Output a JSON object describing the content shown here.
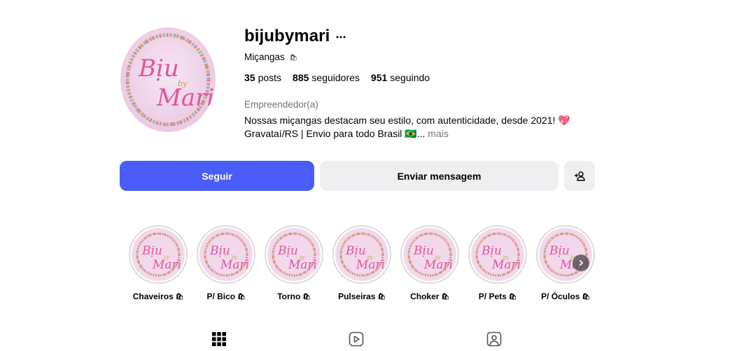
{
  "profile": {
    "username": "bijubymari",
    "category": "Miçangas",
    "category_emoji": "🛍",
    "posts_count": "35",
    "posts_label": "posts",
    "followers_count": "885",
    "followers_label": "seguidores",
    "following_count": "951",
    "following_label": "seguindo",
    "role": "Empreendedor(a)",
    "bio_line1": "Nossas miçangas destacam seu estilo, com autenticidade, desde 2021! 💖",
    "bio_line2": "Gravataí/RS | Envio para todo Brasil 🇧🇷...",
    "bio_more": "mais"
  },
  "avatar_logo": {
    "line1": "Bịu",
    "by": "by",
    "line2": "Mari"
  },
  "buttons": {
    "follow": "Seguir",
    "message": "Enviar mensagem"
  },
  "highlights": [
    {
      "label": "Chaveiros",
      "emoji": "🛍"
    },
    {
      "label": "P/ Bico",
      "emoji": "🛍"
    },
    {
      "label": "Torno",
      "emoji": "🛍"
    },
    {
      "label": "Pulseiras",
      "emoji": "🛍"
    },
    {
      "label": "Choker",
      "emoji": "🛍"
    },
    {
      "label": "P/ Pets",
      "emoji": "🛍"
    },
    {
      "label": "P/ Óculos",
      "emoji": "🛍"
    }
  ],
  "tabs": [
    {
      "icon": "grid-icon"
    },
    {
      "icon": "reels-icon"
    },
    {
      "icon": "tagged-icon"
    }
  ],
  "colors": {
    "follow_button": "#4a5df9",
    "secondary_button": "#efeff2",
    "logo_pink": "#e0559b",
    "logo_bg": "#f3dcec"
  }
}
